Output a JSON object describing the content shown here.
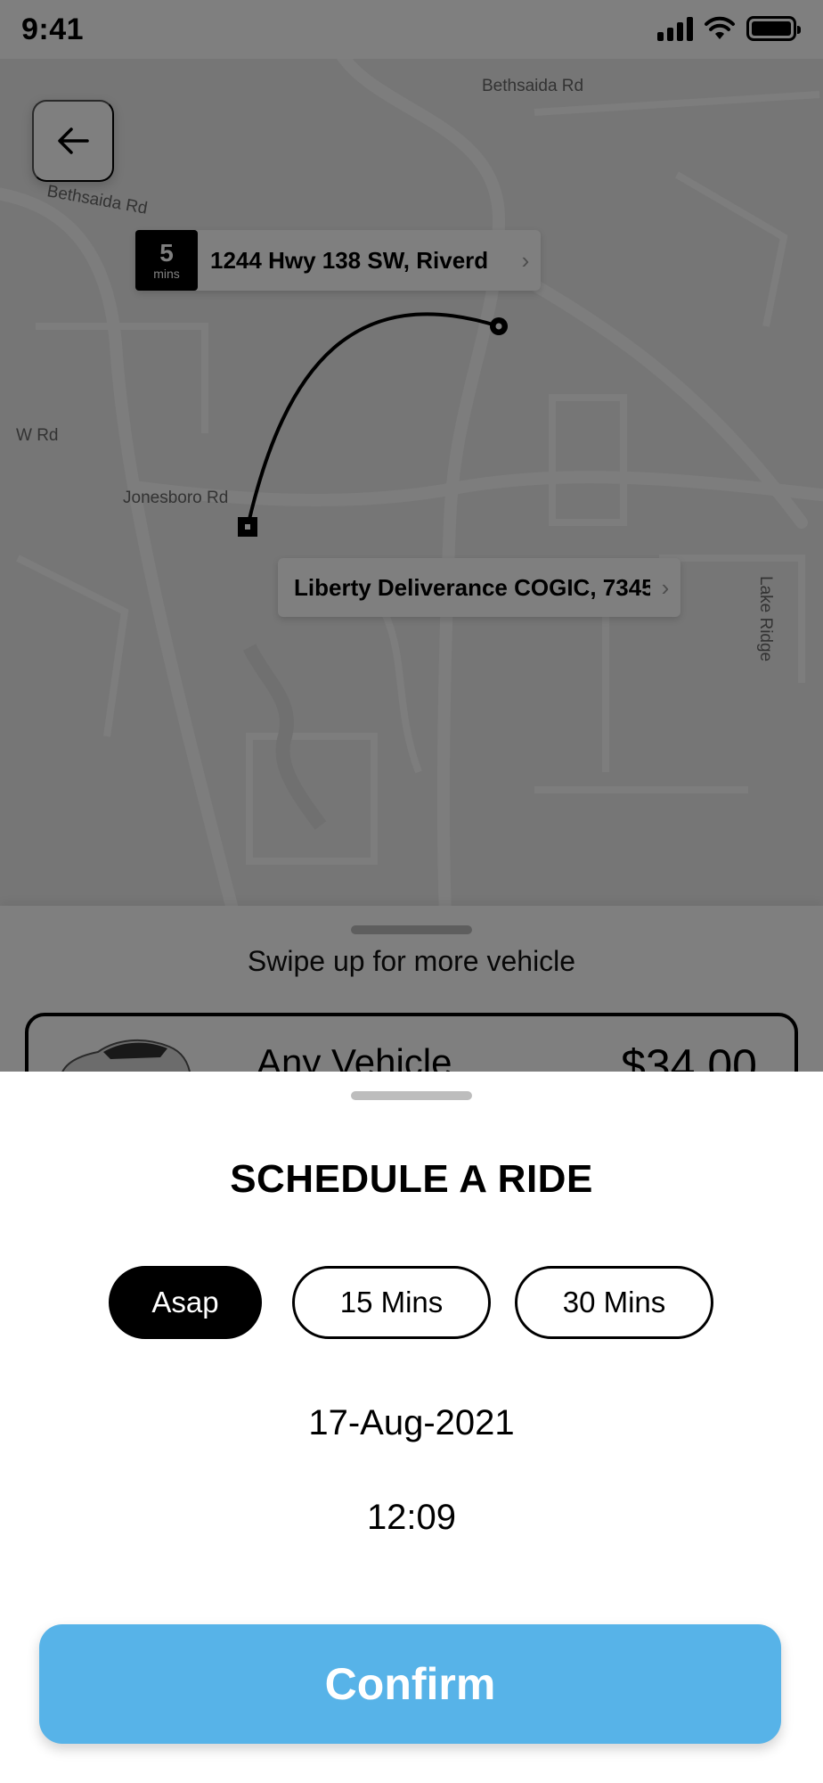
{
  "status_bar": {
    "time": "9:41"
  },
  "map": {
    "road_labels": [
      "Bethsaida Rd",
      "Bethsaida Rd",
      "W Rd",
      "Jonesboro Rd",
      "Lake Ridge"
    ],
    "pickup": {
      "eta_value": "5",
      "eta_unit": "mins",
      "address": "1244 Hwy 138 SW, Riverd"
    },
    "dropoff": {
      "address": "Liberty Deliverance COGIC, 7345"
    }
  },
  "vehicle_sheet": {
    "hint": "Swipe up for more vehicle",
    "vehicle_name": "Any Vehicle",
    "vehicle_price": "$34.00"
  },
  "schedule": {
    "title": "SCHEDULE A RIDE",
    "options": [
      "Asap",
      "15 Mins",
      "30 Mins"
    ],
    "selected_option": "Asap",
    "date": "17-Aug-2021",
    "time": "12:09",
    "confirm_label": "Confirm"
  },
  "colors": {
    "confirm": "#57b3e8",
    "overlay": "rgba(0,0,0,0.5)",
    "selected": "#000000"
  },
  "icons": {
    "back": "arrow-left-icon",
    "chevron": "chevron-right-icon",
    "car": "car-icon"
  }
}
